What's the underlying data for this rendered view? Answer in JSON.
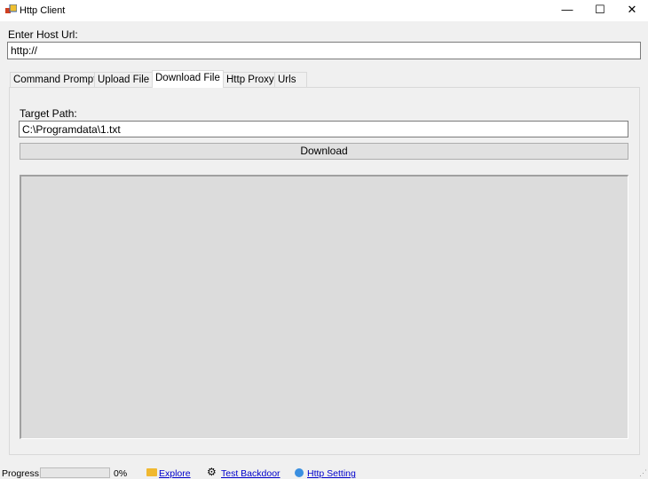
{
  "window": {
    "title": "Http Client",
    "minimize": "—",
    "maximize": "☐",
    "close": "✕"
  },
  "host": {
    "label": "Enter Host Url:",
    "value": "http://"
  },
  "tabs": [
    {
      "label": "Command Prompt"
    },
    {
      "label": "Upload File"
    },
    {
      "label": "Download File",
      "active": true
    },
    {
      "label": "Http Proxy"
    },
    {
      "label": "Urls"
    }
  ],
  "download": {
    "target_label": "Target Path:",
    "target_value": "C:\\Programdata\\1.txt",
    "button": "Download"
  },
  "status": {
    "progress_label": "Progress:",
    "progress_percent": "0%",
    "progress_value": 0,
    "explore": "Explore",
    "test_backdoor": "Test Backdoor",
    "http_setting": "Http Setting"
  }
}
